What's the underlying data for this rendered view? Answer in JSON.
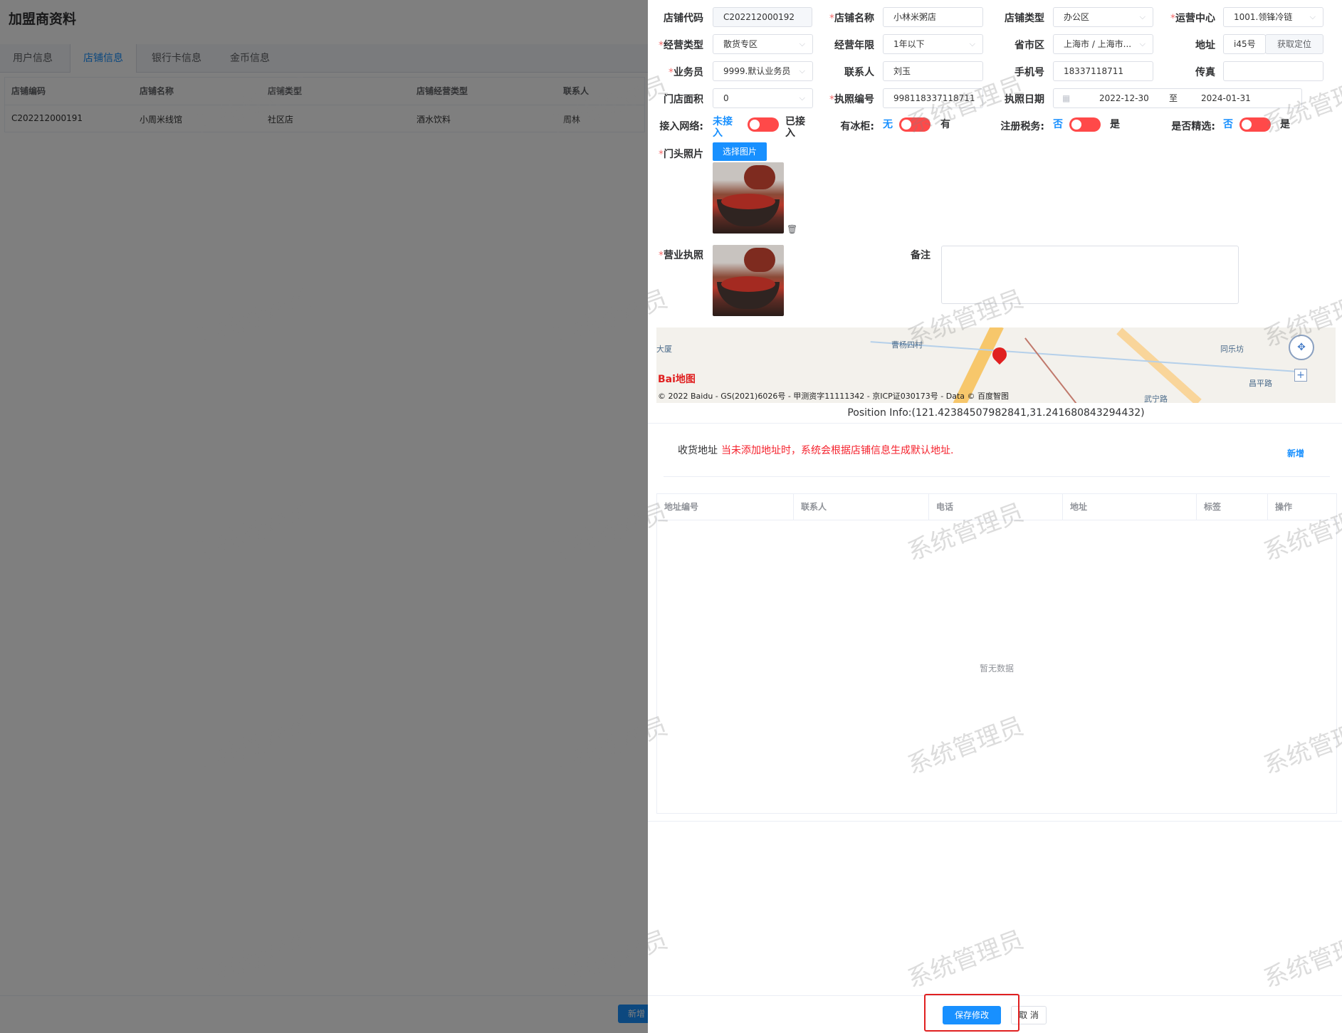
{
  "page": {
    "title": "加盟商资料"
  },
  "tabs": [
    "用户信息",
    "店铺信息",
    "银行卡信息",
    "金币信息"
  ],
  "store_list": {
    "columns": [
      "店铺编码",
      "店铺名称",
      "店铺类型",
      "店铺经营类型",
      "联系人"
    ],
    "rows": [
      [
        "C202212000191",
        "小周米线馆",
        "社区店",
        "酒水饮料",
        "周林"
      ]
    ]
  },
  "background_footer": {
    "add_label": "新增"
  },
  "watermark": "系统管理员",
  "form": {
    "store_code": {
      "label": "店铺代码",
      "value": "C202212000192"
    },
    "store_name": {
      "label": "店铺名称",
      "value": "小林米粥店"
    },
    "store_type": {
      "label": "店铺类型",
      "value": "办公区"
    },
    "ops_center": {
      "label": "运营中心",
      "value": "1001.领锋冷链"
    },
    "biz_type": {
      "label": "经营类型",
      "value": "散货专区"
    },
    "biz_years": {
      "label": "经营年限",
      "value": "1年以下"
    },
    "region": {
      "label": "省市区",
      "value": "上海市 / 上海市..."
    },
    "address": {
      "label": "地址",
      "value": "i45号",
      "locate_label": "获取定位"
    },
    "salesman": {
      "label": "业务员",
      "value": "9999.默认业务员"
    },
    "contact": {
      "label": "联系人",
      "value": "刘玉"
    },
    "phone": {
      "label": "手机号",
      "value": "18337118711"
    },
    "fax": {
      "label": "传真",
      "value": ""
    },
    "area": {
      "label": "门店面积",
      "value": "0"
    },
    "license_no": {
      "label": "执照编号",
      "value": "998118337118711"
    },
    "license_date": {
      "label": "执照日期",
      "start": "2022-12-30",
      "sep": "至",
      "end": "2024-01-31"
    },
    "network": {
      "label": "接入网络:",
      "off": "未接入",
      "on": "已接入"
    },
    "fridge": {
      "label": "有冰柜:",
      "off": "无",
      "on": "有"
    },
    "tax": {
      "label": "注册税务:",
      "off": "否",
      "on": "是"
    },
    "featured": {
      "label": "是否精选:",
      "off": "否",
      "on": "是"
    },
    "door_photo": {
      "label": "门头照片",
      "button": "选择图片"
    },
    "license_photo": {
      "label": "营业执照"
    },
    "remarks": {
      "label": "备注",
      "value": ""
    }
  },
  "map": {
    "attribution": "© 2022 Baidu - GS(2021)6026号 - 甲测资字11111342 - 京ICP证030173号 - Data © 百度智图",
    "logo": "Bai地图",
    "places": [
      "大厦",
      "曹杨四村",
      "同乐坊",
      "昌平路",
      "武宁路"
    ],
    "position_info": "Position Info:(121.42384507982841,31.241680843294432)"
  },
  "shipping": {
    "label": "收货地址",
    "warning": "当未添加地址时，系统会根据店铺信息生成默认地址.",
    "add_label": "新增",
    "columns": [
      "地址编号",
      "联系人",
      "电话",
      "地址",
      "标签",
      "操作"
    ],
    "empty_text": "暂无数据"
  },
  "footer": {
    "save_label": "保存修改",
    "cancel_label": "取 消"
  },
  "colors": {
    "primary": "#1890ff",
    "switch_off": "#ff4949",
    "required": "#f56c6c",
    "highlight": "#e02020"
  }
}
